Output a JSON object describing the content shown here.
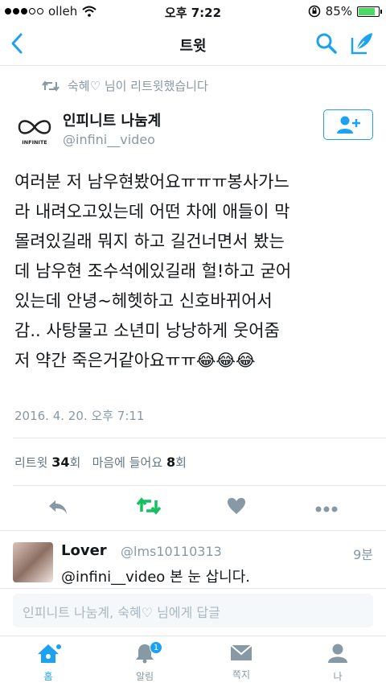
{
  "status_bar": {
    "carrier": "olleh",
    "time": "오후 7:22",
    "battery": "85%",
    "battery_level": 0.85
  },
  "nav": {
    "title": "트윗"
  },
  "retweet_notice": "숙혜♡ 님이 리트윗했습니다",
  "tweet": {
    "author_name": "인피니트 나눔계",
    "author_handle": "@infini__video",
    "logo_text": "INFINITE",
    "lines": [
      "여러분 저 남우현봤어요ㅠㅠㅠ봉사가느",
      "라 내려오고있는데 어떤 차에 애들이 막",
      "몰려있길래 뭐지 하고 길건너면서 봤는",
      "데 남우현 조수석에있길래 헐!하고 굳어",
      "있는데 안녕~헤헷하고 신호바뀌어서",
      "감.. 사탕물고 소년미 낭낭하게 웃어줌",
      "저 약간 죽은거같아요ㅠㅠ"
    ],
    "emojis": "😂😂😂",
    "date": "2016. 4. 20. 오후 7:11",
    "retweet_label": "리트윗",
    "retweet_count": "34",
    "like_label": "마음에 들어요",
    "like_count": "8",
    "count_suffix": "회"
  },
  "reply": {
    "name": "Lover",
    "handle": "@lms10110313",
    "time": "9분",
    "text": "@infini__video 본 눈 삽니다."
  },
  "reply_box": {
    "placeholder": "인피니트 나눔계, 숙혜♡ 님에게 답글"
  },
  "tabs": [
    {
      "label": "홈",
      "icon": "home-icon",
      "active": true
    },
    {
      "label": "알림",
      "icon": "bell-icon",
      "badge": "1"
    },
    {
      "label": "쪽지",
      "icon": "envelope-icon"
    },
    {
      "label": "나",
      "icon": "person-icon"
    }
  ],
  "colors": {
    "accent": "#1da1f2",
    "retweet_green": "#17bf63",
    "muted": "#8899a6"
  }
}
